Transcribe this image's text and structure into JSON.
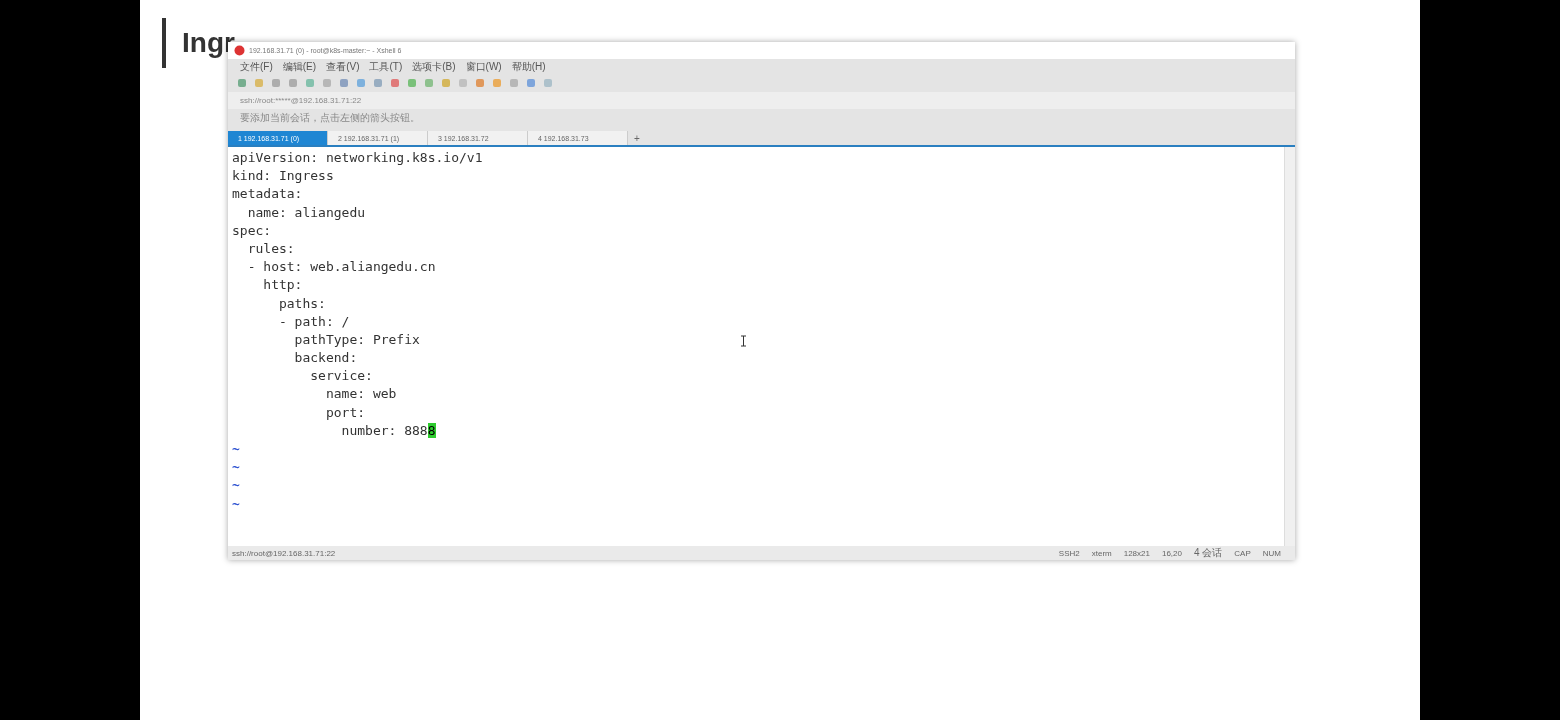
{
  "slide": {
    "title": "Ingr"
  },
  "window": {
    "title": "192.168.31.71 (0) - root@k8s-master:~ - Xshell 6",
    "menu": [
      "文件(F)",
      "编辑(E)",
      "查看(V)",
      "工具(T)",
      "选项卡(B)",
      "窗口(W)",
      "帮助(H)"
    ],
    "address": "ssh://root:*****@192.168.31.71:22",
    "info": "要添加当前会话，点击左侧的箭头按钮。",
    "tabs": [
      {
        "label": "1 192.168.31.71 (0)",
        "selected": true
      },
      {
        "label": "2 192.168.31.71 (1)",
        "selected": false
      },
      {
        "label": "3 192.168.31.72",
        "selected": false
      },
      {
        "label": "4 192.168.31.73",
        "selected": false
      }
    ],
    "new_tab": "+",
    "terminal": {
      "lines": [
        "apiVersion: networking.k8s.io/v1",
        "kind: Ingress",
        "metadata:",
        "  name: aliangedu",
        "spec:",
        "  rules:",
        "  - host: web.aliangedu.cn",
        "    http:",
        "      paths:",
        "      - path: /",
        "        pathType: Prefix",
        "        backend:",
        "          service:",
        "            name: web",
        "            port:",
        "              number: 888"
      ],
      "cursor": "8",
      "tildes": [
        "~",
        "~",
        "~",
        "~"
      ]
    },
    "status_bar": {
      "address": "ssh://root@192.168.31.71:22",
      "items": [
        "SSH2",
        "xterm",
        "128x21",
        "16,20",
        "4 会话",
        "CAP",
        "NUM"
      ]
    }
  }
}
